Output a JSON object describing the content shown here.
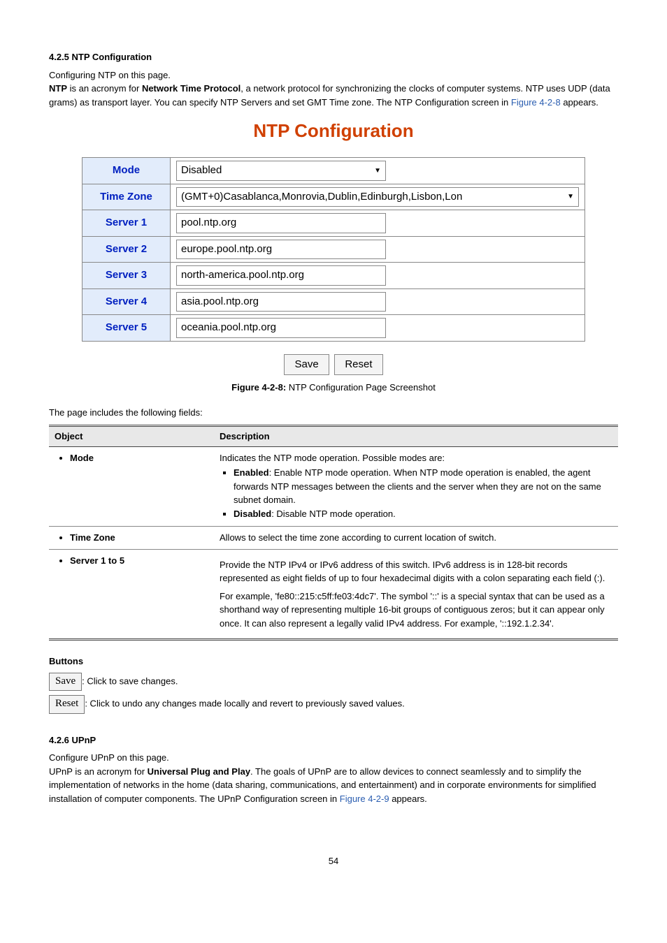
{
  "section_ntp": {
    "heading": "4.2.5 NTP Configuration",
    "line1": "Configuring NTP on this page.",
    "para_pre": "NTP",
    "para_mid1": " is an acronym for ",
    "para_bold": "Network Time Protocol",
    "para_mid2": ", a network protocol for synchronizing the clocks of computer systems. NTP uses UDP (data grams) as transport layer. You can specify NTP Servers and set GMT Time zone. The NTP Configuration screen in ",
    "figure_ref": "Figure 4-2-8",
    "para_end": " appears."
  },
  "figure": {
    "title": "NTP Configuration",
    "rows": {
      "mode": {
        "label": "Mode",
        "value": "Disabled"
      },
      "tz": {
        "label": "Time Zone",
        "value": "(GMT+0)Casablanca,Monrovia,Dublin,Edinburgh,Lisbon,Lon"
      },
      "s1": {
        "label": "Server 1",
        "value": "pool.ntp.org"
      },
      "s2": {
        "label": "Server 2",
        "value": "europe.pool.ntp.org"
      },
      "s3": {
        "label": "Server 3",
        "value": "north-america.pool.ntp.org"
      },
      "s4": {
        "label": "Server 4",
        "value": "asia.pool.ntp.org"
      },
      "s5": {
        "label": "Server 5",
        "value": "oceania.pool.ntp.org"
      }
    },
    "buttons": {
      "save": "Save",
      "reset": "Reset"
    },
    "caption_pre": "Figure 4-2-8:",
    "caption": " NTP Configuration Page Screenshot"
  },
  "fields_intro": "The page includes the following fields:",
  "fields_table": {
    "head_obj": "Object",
    "head_desc": "Description",
    "rows": [
      {
        "obj": "Mode",
        "desc_intro": "Indicates the NTP mode operation. Possible modes are:",
        "items": [
          {
            "k": "Enabled",
            "v": ": Enable NTP mode operation. When NTP mode operation is enabled, the agent forwards NTP messages between the clients and the server when they are not on the same subnet domain."
          },
          {
            "k": "Disabled",
            "v": ": Disable NTP mode operation."
          }
        ]
      },
      {
        "obj": "Time Zone",
        "desc_plain": "Allows to select the time zone according to current location of switch."
      },
      {
        "obj": "Server 1 to 5",
        "desc_p1": "Provide the NTP IPv4 or IPv6 address of this switch. IPv6 address is in 128-bit records represented as eight fields of up to four hexadecimal digits with a colon separating each field (:).",
        "desc_p2": "For example, 'fe80::215:c5ff:fe03:4dc7'. The symbol '::' is a special syntax that can be used as a shorthand way of representing multiple 16-bit groups of contiguous zeros; but it can appear only once. It can also represent a legally valid IPv4 address. For example, '::192.1.2.34'."
      }
    ]
  },
  "buttons_heading": "Buttons",
  "btn_save": {
    "label": "Save",
    "desc": ": Click to save changes."
  },
  "btn_reset": {
    "label": "Reset",
    "desc": ": Click to undo any changes made locally and revert to previously saved values."
  },
  "section_upnp": {
    "heading": "4.2.6 UPnP",
    "line1": "Configure UPnP on this page.",
    "para_mid1": "UPnP is an acronym for ",
    "para_bold": "Universal Plug and Play",
    "para_mid2": ". The goals of UPnP are to allow devices to connect seamlessly and to simplify the implementation of networks in the home (data sharing, communications, and entertainment) and in corporate environments for simplified installation of computer components. The UPnP Configuration screen in ",
    "figure_ref": "Figure 4-2-9",
    "para_end": " appears."
  },
  "page_number": "54"
}
